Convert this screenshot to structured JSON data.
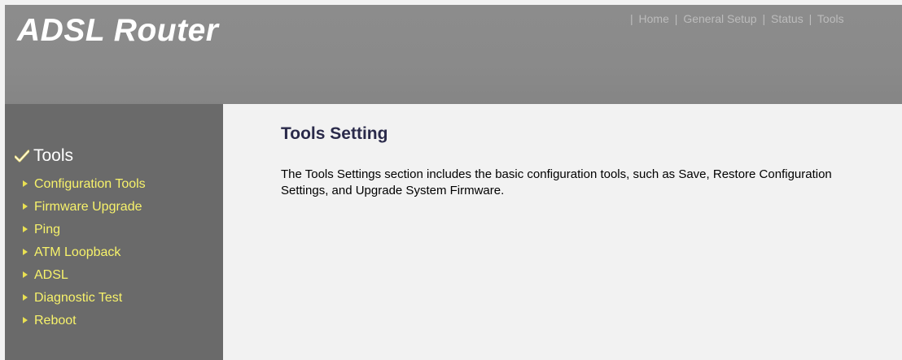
{
  "header": {
    "brand": "ADSL Router",
    "nav": [
      "Home",
      "General Setup",
      "Status",
      "Tools"
    ]
  },
  "sidebar": {
    "title": "Tools",
    "title_icon": "checkmark-icon",
    "item_icon": "arrow-right-icon",
    "items": [
      {
        "label": "Configuration Tools"
      },
      {
        "label": "Firmware Upgrade"
      },
      {
        "label": "Ping"
      },
      {
        "label": "ATM Loopback"
      },
      {
        "label": "ADSL"
      },
      {
        "label": "Diagnostic Test"
      },
      {
        "label": "Reboot"
      }
    ]
  },
  "main": {
    "title": "Tools Setting",
    "description": "The Tools Settings section includes the basic configuration tools, such as Save, Restore Configuration Settings, and Upgrade System Firmware."
  },
  "colors": {
    "header_bg": "#8a8a8a",
    "sidebar_bg": "#6a6a6a",
    "sidebar_link": "#f7f26b",
    "content_bg": "#f2f2f2",
    "title": "#2a2a4a"
  }
}
